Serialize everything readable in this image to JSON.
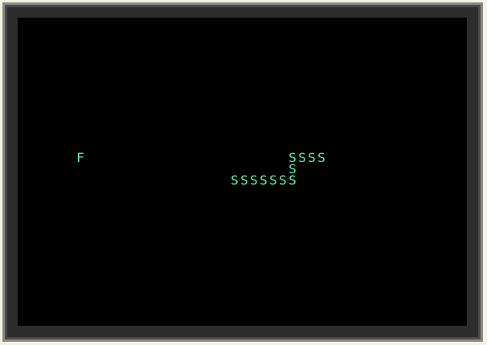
{
  "colors": {
    "foreground": "#5ff5a8",
    "screen_background": "#000000",
    "bezel": "#4a4a4a"
  },
  "game": {
    "food_glyph": "F",
    "snake_glyph": "S",
    "food": {
      "col": 6,
      "row": 12
    },
    "snake": [
      {
        "col": 31,
        "row": 12
      },
      {
        "col": 30,
        "row": 12
      },
      {
        "col": 29,
        "row": 12
      },
      {
        "col": 28,
        "row": 12
      },
      {
        "col": 28,
        "row": 13
      },
      {
        "col": 28,
        "row": 14
      },
      {
        "col": 27,
        "row": 14
      },
      {
        "col": 26,
        "row": 14
      },
      {
        "col": 25,
        "row": 14
      },
      {
        "col": 24,
        "row": 14
      },
      {
        "col": 23,
        "row": 14
      },
      {
        "col": 22,
        "row": 14
      }
    ]
  }
}
